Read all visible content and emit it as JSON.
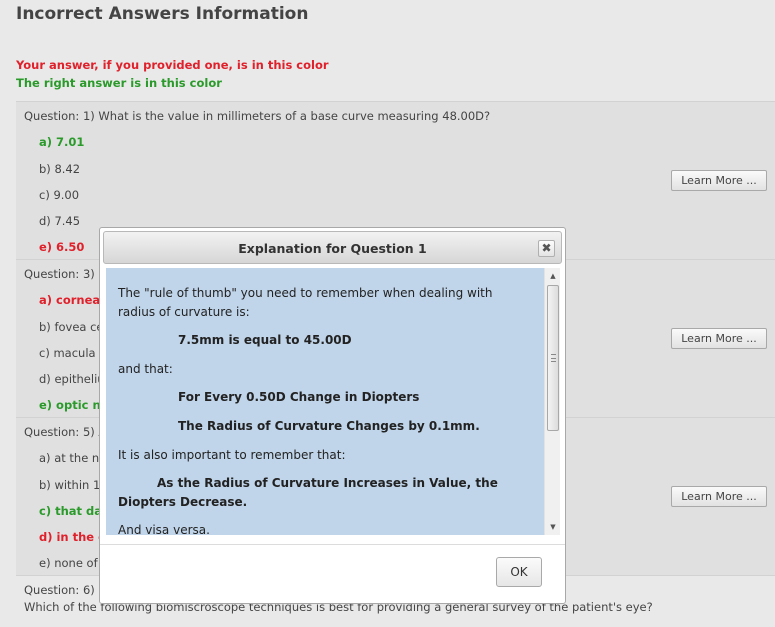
{
  "page": {
    "title": "Incorrect Answers Information",
    "legend_wrong": "Your answer, if you provided one, is in this color",
    "legend_right": "The right answer is in this color"
  },
  "colors": {
    "wrong": "#e0202a",
    "right": "#2a9a2a",
    "dialog_content_bg": "#c0d5ea"
  },
  "learn_more_label": "Learn More ...",
  "questions": [
    {
      "text": "Question: 1) What is the value in millimeters of a base curve measuring 48.00D?",
      "answers": [
        "a) 7.01",
        "b) 8.42",
        "c) 9.00",
        "d) 7.45",
        "e) 6.50"
      ]
    },
    {
      "text": "Question: 3) C",
      "answers": [
        "a) cornea",
        "b) fovea ce",
        "c) macula",
        "d) epitheliu",
        "e) optic ne"
      ]
    },
    {
      "text": "Question: 5) A",
      "answers": [
        "a) at the ne",
        "b) within 1",
        "c) that day",
        "d) in the er",
        "e) none of t"
      ]
    },
    {
      "text": "Question: 6)",
      "line2": "Which of the following biomiscroscope techniques is best for providing a general survey of the patient's eye?"
    }
  ],
  "dialog": {
    "title": "Explanation for Question 1",
    "close_icon": "✖",
    "p1": "The \"rule of thumb\" you need to remember when dealing with radius of curvature is:",
    "b1": "7.5mm is equal to 45.00D",
    "p2": "and that:",
    "b2": "For Every 0.50D Change in Diopters",
    "b3": "The Radius of Curvature Changes by 0.1mm.",
    "p3": "It is also important to remember that:",
    "b4": "As the Radius of Curvature Increases in Value, the Diopters Decrease.",
    "p4": "And visa versa.",
    "ok_label": "OK"
  }
}
